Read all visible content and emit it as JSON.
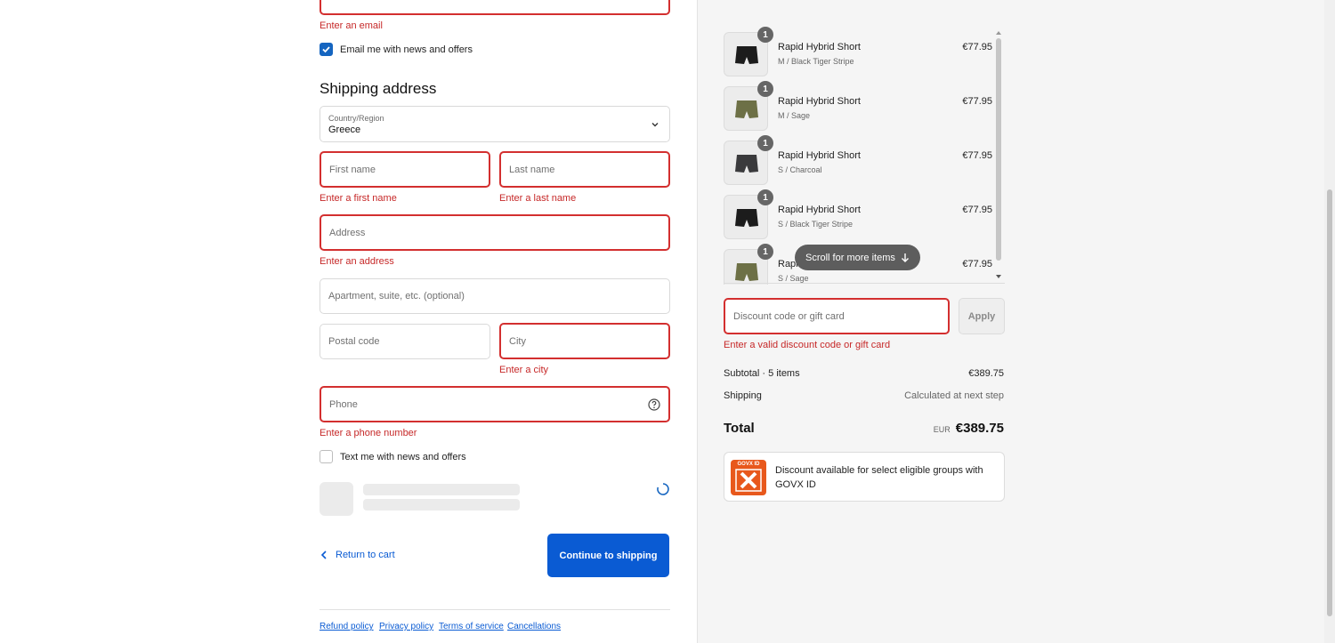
{
  "contact": {
    "email_error": "Enter an email",
    "email_optin_label": "Email me with news and offers",
    "email_optin_checked": true
  },
  "shipping": {
    "heading": "Shipping address",
    "country_label": "Country/Region",
    "country_value": "Greece",
    "first_name_placeholder": "First name",
    "first_name_error": "Enter a first name",
    "last_name_placeholder": "Last name",
    "last_name_error": "Enter a last name",
    "address_placeholder": "Address",
    "address_error": "Enter an address",
    "apartment_placeholder": "Apartment, suite, etc. (optional)",
    "postal_placeholder": "Postal code",
    "city_placeholder": "City",
    "city_error": "Enter a city",
    "phone_placeholder": "Phone",
    "phone_error": "Enter a phone number",
    "text_optin_label": "Text me with news and offers",
    "text_optin_checked": false
  },
  "actions": {
    "return_label": "Return to cart",
    "continue_label": "Continue to shipping"
  },
  "footer": {
    "links": [
      "Refund policy",
      "Privacy policy",
      "Terms of service",
      "Cancellations"
    ]
  },
  "cart": {
    "items": [
      {
        "name": "Rapid Hybrid Short",
        "variant": "M / Black Tiger Stripe",
        "price": "€77.95",
        "qty": "1",
        "color": "#1c1c1c"
      },
      {
        "name": "Rapid Hybrid Short",
        "variant": "M / Sage",
        "price": "€77.95",
        "qty": "1",
        "color": "#6d7046"
      },
      {
        "name": "Rapid Hybrid Short",
        "variant": "S / Charcoal",
        "price": "€77.95",
        "qty": "1",
        "color": "#3a3a3c"
      },
      {
        "name": "Rapid Hybrid Short",
        "variant": "S / Black Tiger Stripe",
        "price": "€77.95",
        "qty": "1",
        "color": "#1c1c1c"
      },
      {
        "name": "Rapid Hybrid Short",
        "variant": "S / Sage",
        "price": "€77.95",
        "qty": "1",
        "color": "#6d7046"
      }
    ],
    "scroll_hint": "Scroll for more items",
    "discount_placeholder": "Discount code or gift card",
    "discount_error": "Enter a valid discount code or gift card",
    "apply_label": "Apply",
    "subtotal_label": "Subtotal · 5 items",
    "subtotal_value": "€389.75",
    "shipping_label": "Shipping",
    "shipping_value": "Calculated at next step",
    "total_label": "Total",
    "total_currency": "EUR",
    "total_value": "€389.75",
    "govx_text": "Discount available for select eligible groups with GOVX ID",
    "govx_logo_text": "GOVX ID"
  },
  "colors": {
    "accent": "#0a5bd3",
    "error": "#d32f2f",
    "govx": "#e8581c"
  }
}
